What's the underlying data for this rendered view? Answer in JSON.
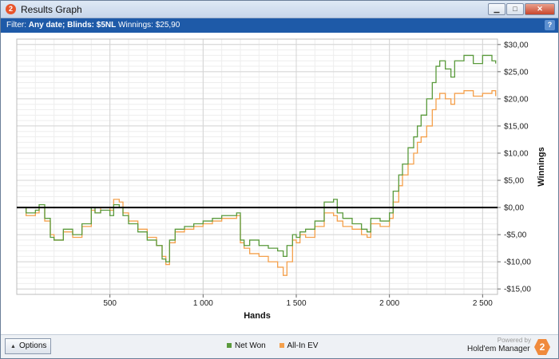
{
  "window": {
    "title": "Results Graph",
    "app_icon_label": "2",
    "buttons": {
      "minimize": "▁",
      "maximize": "□",
      "close": "✕"
    }
  },
  "filter_bar": {
    "prefix": "Filter:",
    "date": "Any date;",
    "blinds": "Blinds: $5NL",
    "winnings": "Winnings: $25,90",
    "help": "?"
  },
  "footer": {
    "options_label": "Options",
    "powered_by": "Powered by",
    "brand": "Hold'em Manager",
    "brand_logo": "2"
  },
  "colors": {
    "net_won": "#5a9a3c",
    "all_in_ev": "#f4a04c",
    "zero_line": "#000000"
  },
  "chart_data": {
    "type": "line",
    "xlabel": "Hands",
    "ylabel": "Winnings",
    "xlim": [
      0,
      2580
    ],
    "ylim": [
      -16,
      31
    ],
    "x_ticks": [
      500,
      1000,
      1500,
      2000,
      2500
    ],
    "x_tick_labels": [
      "500",
      "1 000",
      "1 500",
      "2 000",
      "2 500"
    ],
    "y_ticks": [
      30,
      25,
      20,
      15,
      10,
      5,
      0,
      -5,
      -10,
      -15
    ],
    "y_tick_labels": [
      "$30,00",
      "$25,00",
      "$20,00",
      "$15,00",
      "$10,00",
      "$5,00",
      "$0,00",
      "-$5,00",
      "-$10,00",
      "-$15,00"
    ],
    "grid": true,
    "series": [
      {
        "name": "Net Won",
        "x": [
          0,
          50,
          100,
          120,
          150,
          180,
          200,
          250,
          300,
          350,
          400,
          420,
          450,
          500,
          520,
          550,
          570,
          600,
          650,
          700,
          750,
          780,
          800,
          820,
          850,
          900,
          950,
          1000,
          1050,
          1100,
          1150,
          1180,
          1200,
          1220,
          1250,
          1300,
          1350,
          1400,
          1430,
          1450,
          1480,
          1500,
          1520,
          1550,
          1600,
          1650,
          1670,
          1700,
          1720,
          1750,
          1800,
          1850,
          1880,
          1900,
          1950,
          2000,
          2020,
          2050,
          2070,
          2100,
          2130,
          2150,
          2170,
          2200,
          2230,
          2250,
          2270,
          2300,
          2330,
          2350,
          2400,
          2450,
          2500,
          2550,
          2570
        ],
        "values": [
          0,
          -1,
          -0.5,
          0.5,
          -2,
          -5.5,
          -6,
          -4,
          -5,
          -3,
          0,
          -1,
          -0.5,
          -1.5,
          0.5,
          0,
          -1.5,
          -3,
          -4.5,
          -6,
          -7,
          -9.5,
          -10,
          -6,
          -4,
          -3.5,
          -3,
          -2.5,
          -2,
          -1.5,
          -1.5,
          -1,
          -6,
          -7,
          -6,
          -7,
          -7.5,
          -8,
          -9,
          -7,
          -5,
          -5.5,
          -4.5,
          -4,
          -2.5,
          1,
          1,
          1.5,
          -1,
          -2,
          -3,
          -4,
          -4.5,
          -2,
          -2.5,
          -1,
          3,
          6,
          8,
          11,
          13,
          15,
          17,
          20,
          23,
          26,
          27,
          25.5,
          24,
          27,
          28,
          26.5,
          28,
          27,
          26.5
        ]
      },
      {
        "name": "All-In EV",
        "x": [
          0,
          50,
          100,
          120,
          150,
          180,
          200,
          250,
          300,
          350,
          400,
          420,
          450,
          500,
          520,
          550,
          570,
          600,
          650,
          700,
          750,
          780,
          800,
          820,
          850,
          900,
          950,
          1000,
          1050,
          1100,
          1150,
          1180,
          1200,
          1220,
          1250,
          1300,
          1350,
          1400,
          1430,
          1450,
          1480,
          1500,
          1520,
          1550,
          1600,
          1650,
          1670,
          1700,
          1720,
          1750,
          1800,
          1850,
          1880,
          1900,
          1950,
          2000,
          2020,
          2050,
          2070,
          2100,
          2130,
          2150,
          2170,
          2200,
          2230,
          2250,
          2270,
          2300,
          2330,
          2350,
          2400,
          2450,
          2500,
          2550,
          2570
        ],
        "values": [
          0,
          -1.5,
          -1,
          0,
          -2.5,
          -5,
          -6,
          -4.5,
          -5.5,
          -3.5,
          -0.5,
          -1,
          0,
          -0.5,
          1.5,
          1,
          -1,
          -2.5,
          -4,
          -5.5,
          -7,
          -9,
          -10.5,
          -6.5,
          -4.5,
          -4,
          -3.5,
          -3,
          -2.5,
          -2,
          -2,
          -1.5,
          -6.5,
          -7.5,
          -8.5,
          -9,
          -10,
          -11,
          -12.5,
          -10,
          -6,
          -6.5,
          -5,
          -5.5,
          -3.5,
          -1,
          -1,
          -1.5,
          -2.5,
          -3.5,
          -4,
          -5,
          -5.5,
          -3,
          -3.5,
          -2,
          1,
          4,
          6,
          8,
          10,
          12,
          13,
          15,
          18,
          20,
          21,
          20,
          19,
          21,
          21.5,
          20.5,
          21,
          21.5,
          20.5
        ]
      }
    ]
  }
}
